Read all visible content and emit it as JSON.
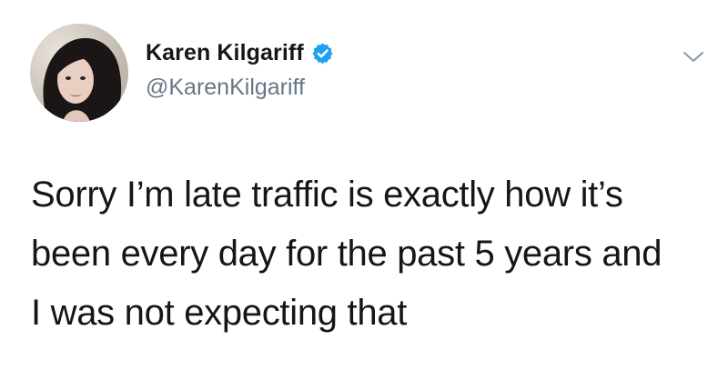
{
  "author": {
    "display_name": "Karen Kilgariff",
    "handle": "@KarenKilgariff",
    "verified": true,
    "avatar_icon": "profile-photo",
    "verified_icon": "verified-badge-icon",
    "verified_color": "#1da1f2"
  },
  "menu": {
    "icon": "chevron-down-icon"
  },
  "tweet": {
    "lines": [
      "Sorry I’m late traffic is exactly how it’s",
      "been every day for the past 5 years and",
      "I was not expecting that"
    ]
  },
  "colors": {
    "text": "#14171a",
    "secondary": "#657786",
    "background": "#ffffff"
  }
}
